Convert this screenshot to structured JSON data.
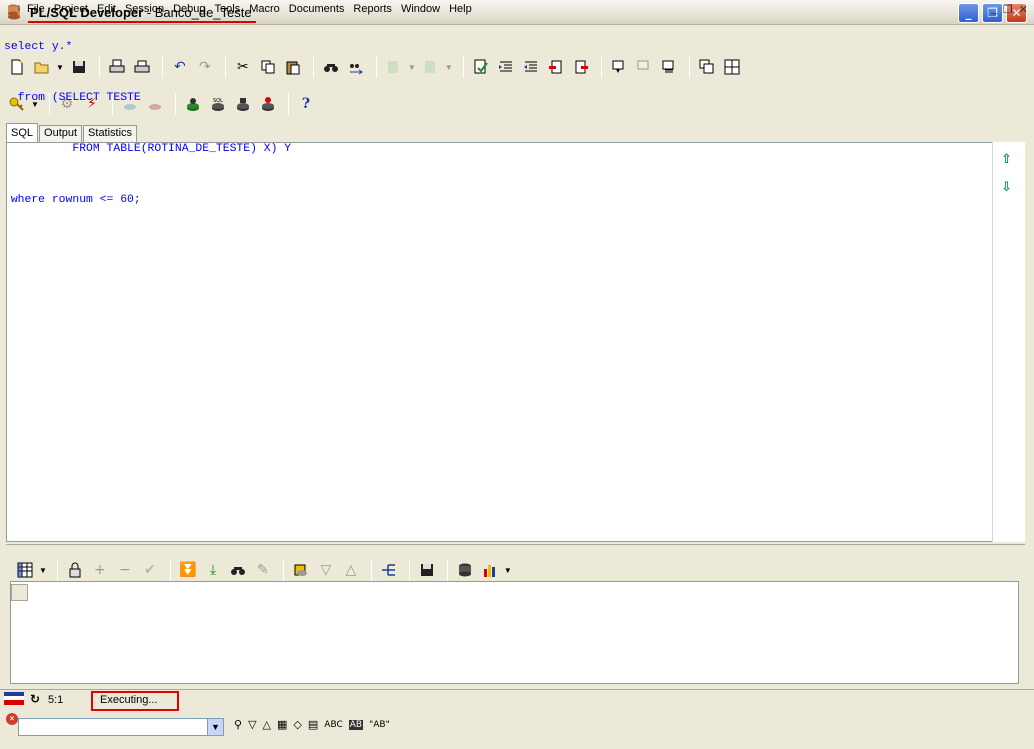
{
  "window": {
    "title_app": "PL/SQL Developer",
    "title_sep": " - ",
    "title_db": "Banco_de_Teste",
    "minimize": "_",
    "maximize": "❐",
    "close": "✕"
  },
  "menu": {
    "items": [
      "File",
      "Project",
      "Edit",
      "Session",
      "Debug",
      "Tools",
      "Macro",
      "Documents",
      "Reports",
      "Window",
      "Help"
    ],
    "mdi_minimize": "_",
    "mdi_restore": "❐",
    "mdi_close": "✕"
  },
  "tabs": [
    "SQL",
    "Output",
    "Statistics"
  ],
  "editor": {
    "lines": [
      "select y.*",
      "  from (SELECT TESTE",
      "          FROM TABLE(ROTINA_DE_TESTE) X) Y",
      " where rownum <= 60;"
    ]
  },
  "status": {
    "position": "5:1",
    "message": "Executing..."
  },
  "findbar": {
    "value": "",
    "abc_label": "ABC",
    "quote_label": "\"AB\""
  },
  "colors": {
    "title_underline": "#e00000",
    "status_highlight": "#e00000",
    "keyword": "#0000ff"
  }
}
